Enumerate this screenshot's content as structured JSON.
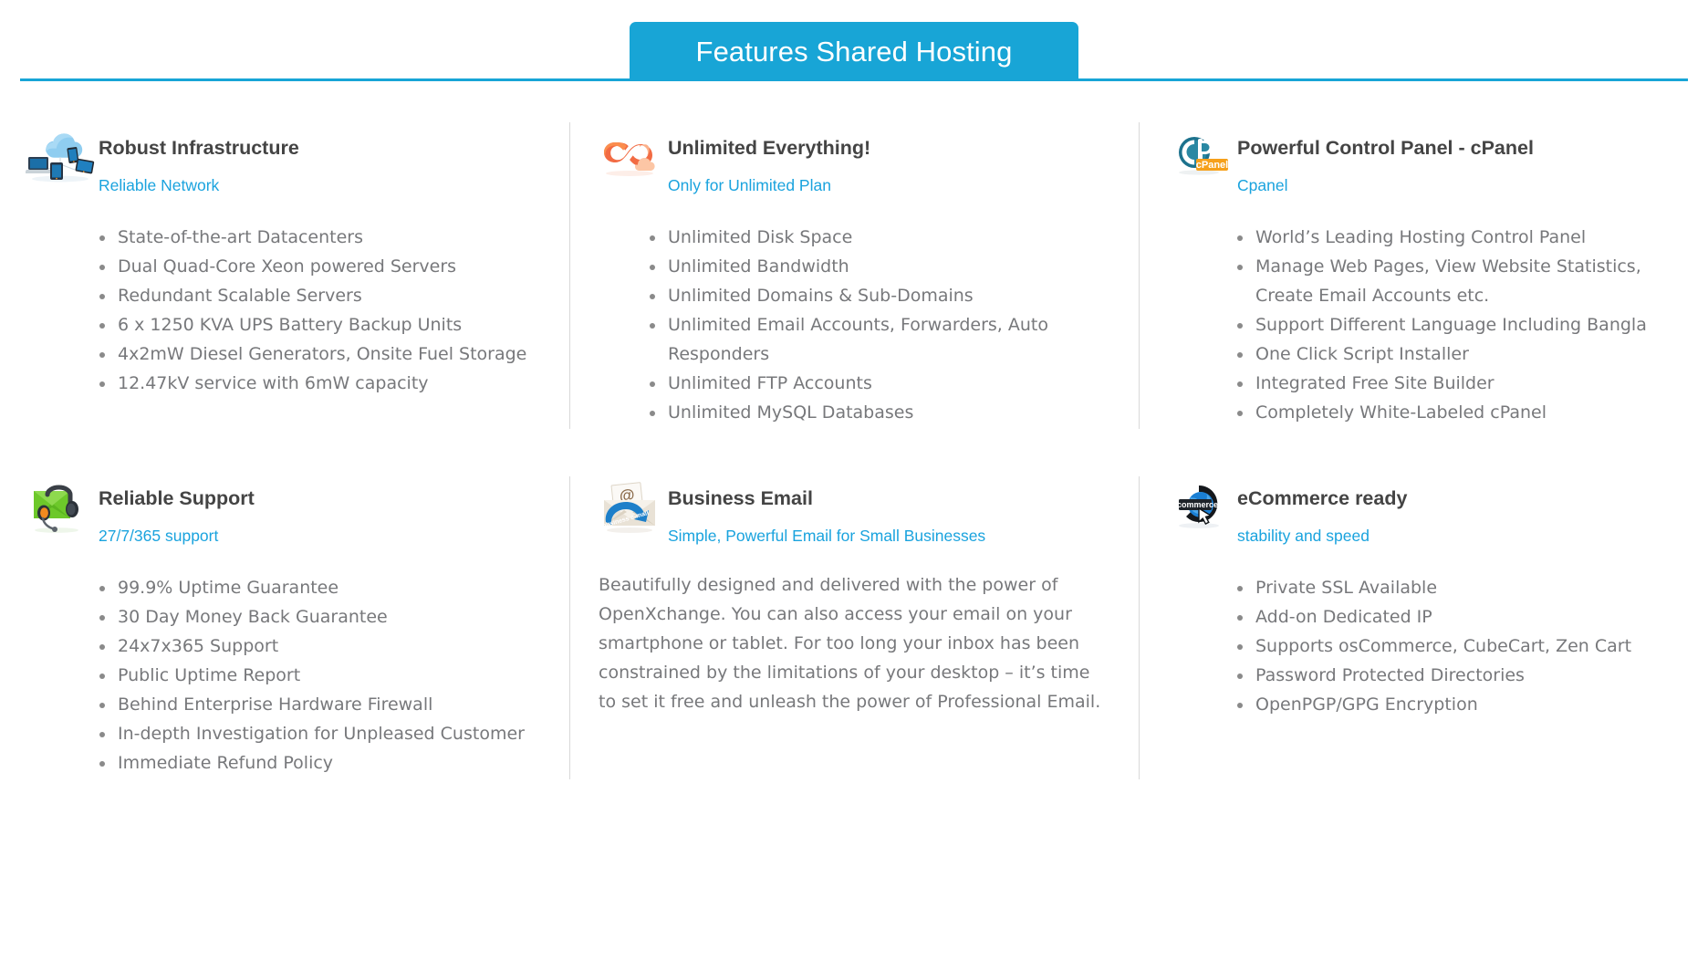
{
  "header": {
    "title": "Features Shared Hosting",
    "banner_color": "#18a5d6",
    "rule_color": "#18a5d6",
    "text_color": "#ffffff"
  },
  "theme": {
    "link_color": "#1aa3de",
    "title_color": "#444444",
    "body_text_color": "#77787b",
    "divider_color": "#d9d9d9"
  },
  "features": [
    {
      "icon": "cloud-devices-icon",
      "title": "Robust Infrastructure",
      "subtitle": "Reliable Network",
      "items": [
        "State-of-the-art Datacenters",
        "Dual Quad-Core Xeon powered Servers",
        "Redundant Scalable Servers",
        "6 x 1250 KVA UPS Battery Backup Units",
        "4x2mW Diesel Generators, Onsite Fuel Storage",
        "12.47kV service with 6mW capacity"
      ]
    },
    {
      "icon": "infinity-cloud-icon",
      "title": "Unlimited Everything!",
      "subtitle": "Only for Unlimited Plan",
      "items": [
        "Unlimited Disk Space",
        "Unlimited Bandwidth",
        "Unlimited Domains & Sub-Domains",
        "Unlimited Email Accounts, Forwarders, Auto Responders",
        "Unlimited FTP Accounts",
        "Unlimited MySQL Databases"
      ]
    },
    {
      "icon": "cpanel-logo-icon",
      "title": "Powerful Control Panel - cPanel",
      "subtitle": "Cpanel",
      "items": [
        "World’s Leading Hosting Control Panel",
        "Manage Web Pages, View Website Statistics, Create Email Accounts etc.",
        "Support Different Language Including Bangla",
        "One Click Script Installer",
        "Integrated Free Site Builder",
        "Completely White-Labeled cPanel"
      ]
    },
    {
      "icon": "headset-envelope-icon",
      "title": "Reliable Support",
      "subtitle": "27/7/365 support",
      "items": [
        "99.9% Uptime Guarantee",
        "30 Day Money Back Guarantee",
        "24x7x365 Support",
        "Public Uptime Report",
        "Behind Enterprise Hardware Firewall",
        "In-depth Investigation for Unpleased Customer",
        "Immediate Refund Policy"
      ]
    },
    {
      "icon": "business-email-envelope-icon",
      "title": "Business Email",
      "subtitle": "Simple, Powerful Email for Small Businesses",
      "paragraph": "Beautifully designed and delivered with the power of OpenXchange. You can also access your email on your smartphone or tablet. For too long your inbox has been constrained by the limitations of your desktop – it’s time to set it free and unleash the power of Professional Email."
    },
    {
      "icon": "ecommerce-globe-icon",
      "title": "eCommerce ready",
      "subtitle": "stability and speed",
      "items": [
        "Private SSL Available",
        "Add-on Dedicated IP",
        "Supports osCommerce, CubeCart, Zen Cart",
        "Password Protected Directories",
        "OpenPGP/GPG Encryption"
      ]
    }
  ]
}
